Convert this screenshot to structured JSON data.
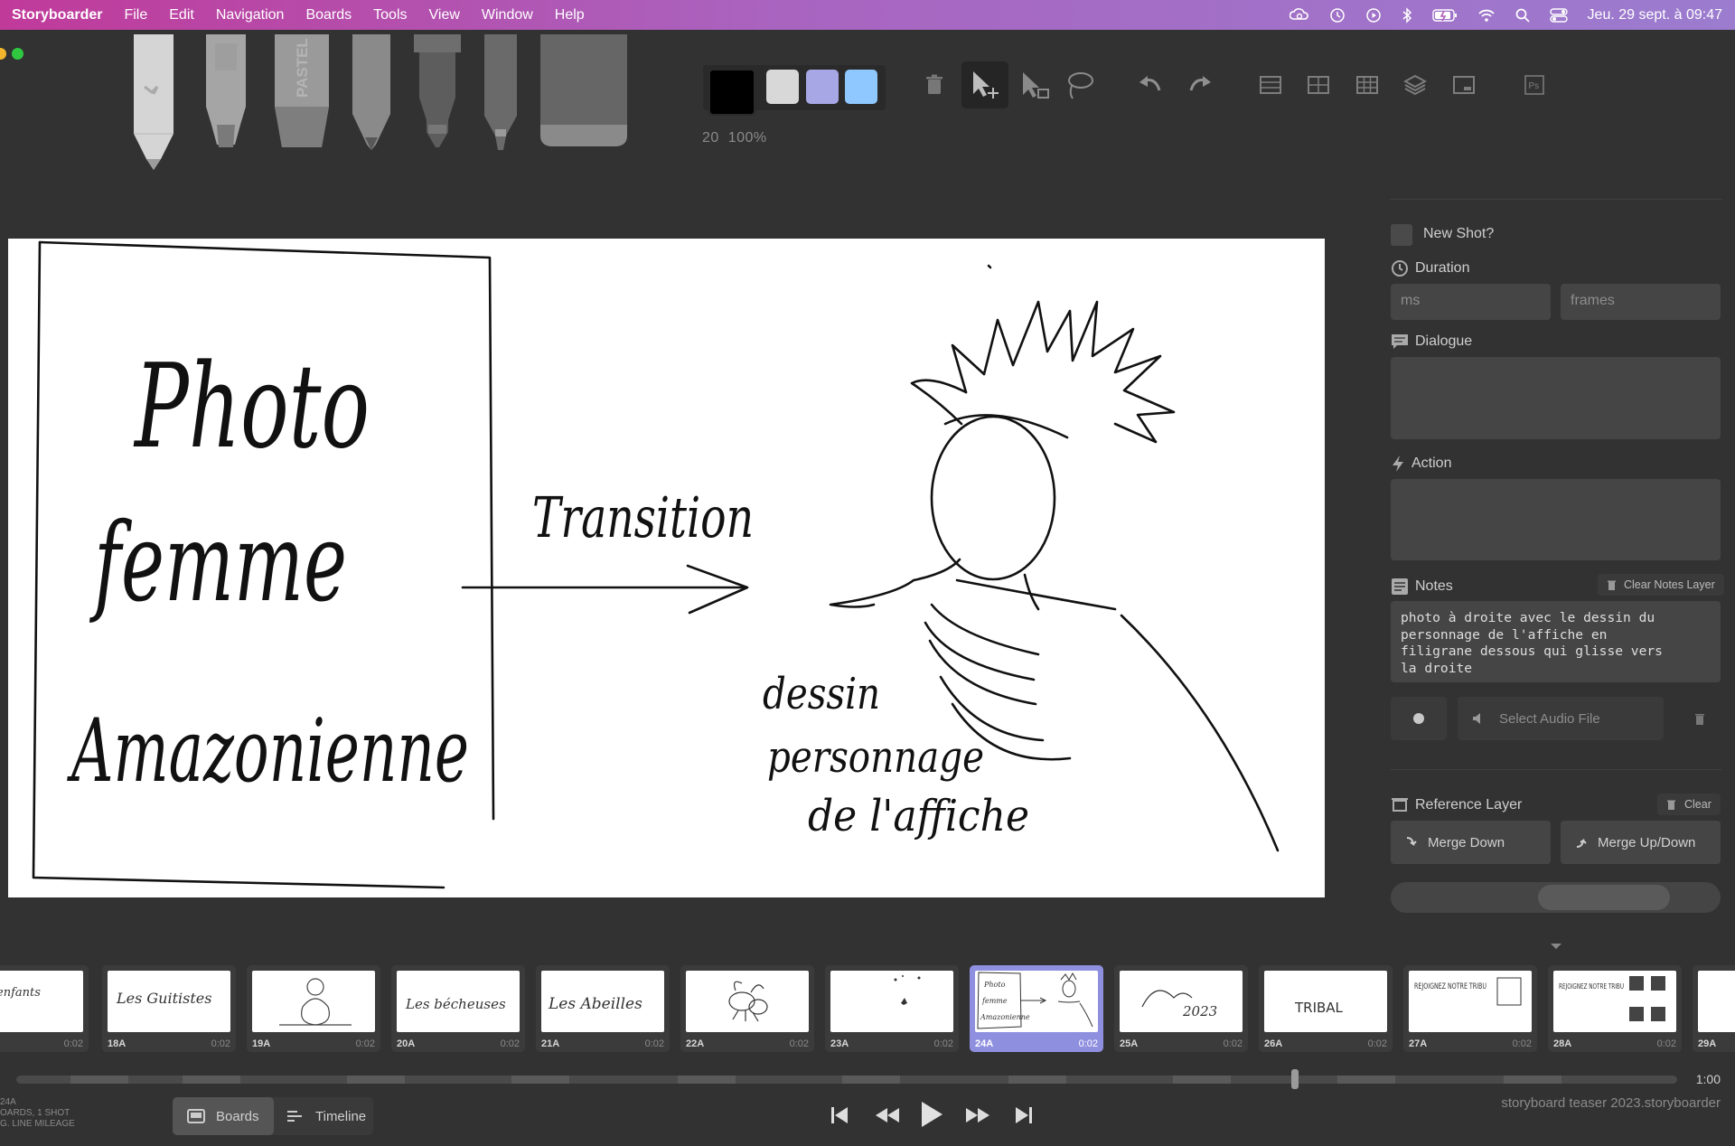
{
  "menubar": {
    "app": "Storyboarder",
    "menus": [
      "File",
      "Edit",
      "Navigation",
      "Boards",
      "Tools",
      "View",
      "Window",
      "Help"
    ],
    "clock": "Jeu. 29 sept. à 09:47"
  },
  "brush": {
    "size": "20",
    "opacity": "100%"
  },
  "colors": {
    "swatches": [
      "#000000",
      "#d8d8d8",
      "#a7a7e6",
      "#8ec8ff"
    ],
    "accent": "#8f8fe0"
  },
  "panel": {
    "new_shot": "New Shot?",
    "duration": "Duration",
    "ms_placeholder": "ms",
    "frames_placeholder": "frames",
    "dialogue": "Dialogue",
    "action": "Action",
    "notes": "Notes",
    "clear_notes": "Clear Notes Layer",
    "notes_text": "photo à droite avec le dessin du\npersonnage de l'affiche en\nfiligrane dessous qui glisse vers\nla droite",
    "select_audio": "Select Audio File",
    "reference_layer": "Reference Layer",
    "clear": "Clear",
    "merge_down": "Merge Down",
    "merge_up_down": "Merge Up/Down"
  },
  "canvas_text": {
    "left": [
      "Photo",
      "femme",
      "Amazonienne"
    ],
    "transition": "Transition",
    "caption": [
      "dessin",
      "personnage",
      "de l'affiche"
    ]
  },
  "thumbnails": [
    {
      "num": "",
      "dur": "0:02",
      "sketch": "enfants"
    },
    {
      "num": "18A",
      "dur": "0:02",
      "sketch": "Les Guitistes"
    },
    {
      "num": "19A",
      "dur": "0:02",
      "sketch": ""
    },
    {
      "num": "20A",
      "dur": "0:02",
      "sketch": "Les bécheuses"
    },
    {
      "num": "21A",
      "dur": "0:02",
      "sketch": "Les Abeilles"
    },
    {
      "num": "22A",
      "dur": "0:02",
      "sketch": ""
    },
    {
      "num": "23A",
      "dur": "0:02",
      "sketch": ""
    },
    {
      "num": "24A",
      "dur": "0:02",
      "sketch": ""
    },
    {
      "num": "25A",
      "dur": "0:02",
      "sketch": "2023"
    },
    {
      "num": "26A",
      "dur": "0:02",
      "sketch": "TRIBAL"
    },
    {
      "num": "27A",
      "dur": "0:02",
      "sketch": "REJOIGNEZ NOTRE TRIBU"
    },
    {
      "num": "28A",
      "dur": "0:02",
      "sketch": "REJOIGNEZ NOTRE TRIBU"
    },
    {
      "num": "29A",
      "dur": "",
      "sketch": ""
    }
  ],
  "scrubber": {
    "total": "1:00"
  },
  "meta": {
    "line1": "24A",
    "line2": "OARDS, 1 SHOT",
    "line3": "G. LINE MILEAGE"
  },
  "view_toggle": {
    "boards": "Boards",
    "timeline": "Timeline"
  },
  "filename": "storyboard teaser 2023.storyboarder"
}
